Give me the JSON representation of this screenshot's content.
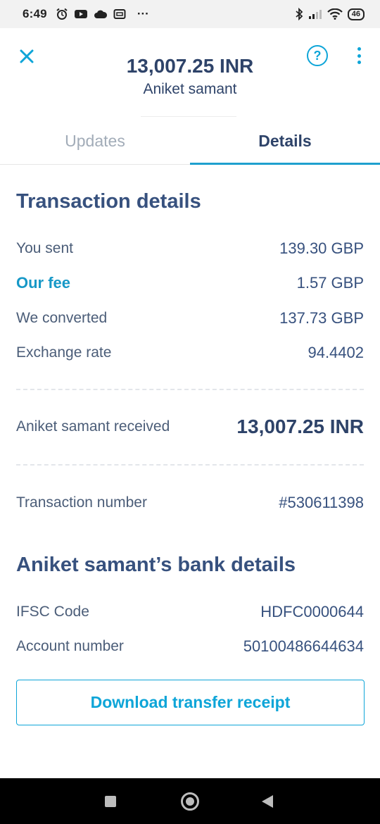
{
  "status_bar": {
    "time": "6:49",
    "more": "···",
    "battery": "46",
    "icons": [
      "alarm-icon",
      "youtube-icon",
      "cloud-icon",
      "app-icon",
      "bluetooth-icon",
      "signal-icon",
      "wifi-icon",
      "battery-icon"
    ]
  },
  "header": {
    "amount": "13,007.25 INR",
    "recipient": "Aniket samant",
    "help_label": "?"
  },
  "tabs": [
    {
      "label": "Updates",
      "active": false
    },
    {
      "label": "Details",
      "active": true
    }
  ],
  "transaction": {
    "title": "Transaction details",
    "rows": [
      {
        "label": "You sent",
        "value": "139.30 GBP"
      },
      {
        "label": "Our fee",
        "value": "1.57 GBP"
      },
      {
        "label": "We converted",
        "value": "137.73 GBP"
      },
      {
        "label": "Exchange rate",
        "value": "94.4402"
      }
    ],
    "received": {
      "label": "Aniket samant received",
      "value": "13,007.25 INR"
    },
    "number": {
      "label": "Transaction number",
      "value": "#530611398"
    }
  },
  "bank": {
    "title": "Aniket samant’s bank details",
    "rows": [
      {
        "label": "IFSC Code",
        "value": "HDFC0000644"
      },
      {
        "label": "Account number",
        "value": "50100486644634"
      }
    ]
  },
  "actions": {
    "download_label": "Download transfer receipt"
  },
  "colors": {
    "accent": "#0ea5d8",
    "text_primary": "#37517e",
    "tab_inactive": "#a2acb8"
  }
}
